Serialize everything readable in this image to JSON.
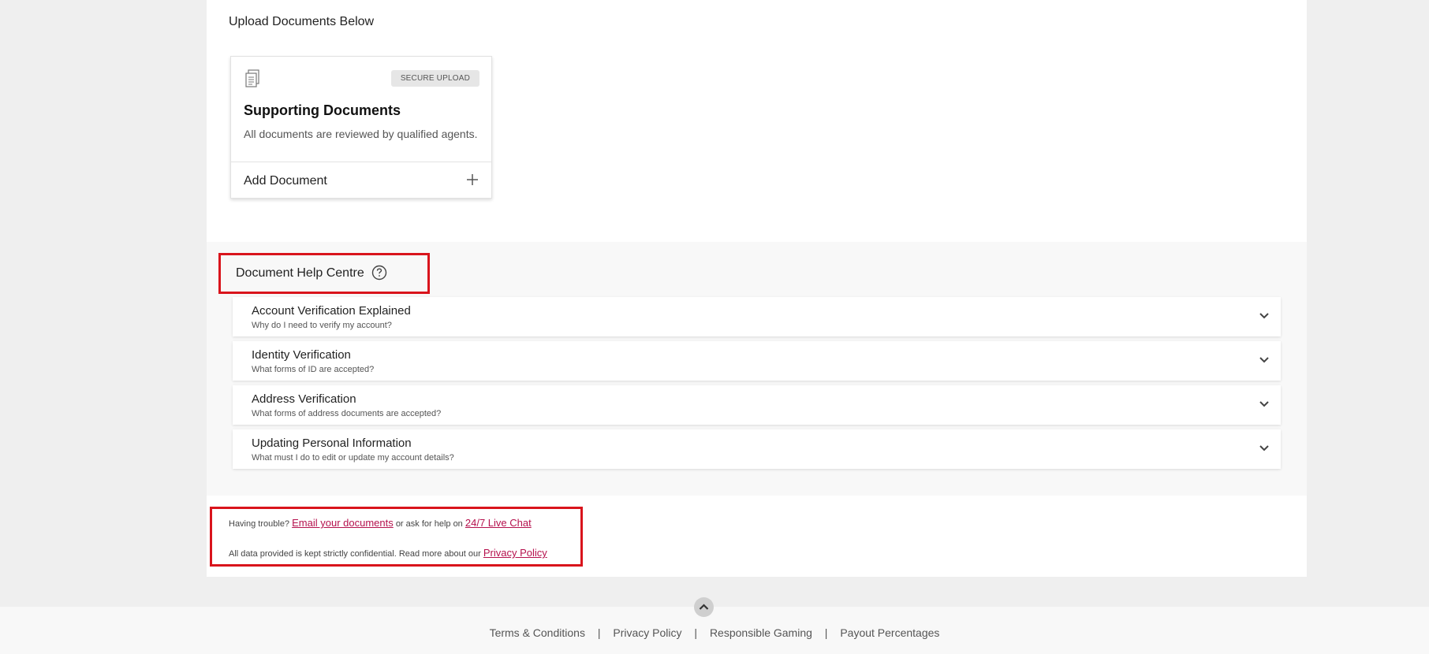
{
  "upload_section": {
    "heading": "Upload Documents Below"
  },
  "doc_card": {
    "icon": "document-icon",
    "badge": "SECURE UPLOAD",
    "title": "Supporting Documents",
    "description": "All documents are reviewed by qualified agents.",
    "add_label": "Add Document",
    "add_icon": "plus-icon"
  },
  "help_centre": {
    "title": "Document Help Centre",
    "icon": "question-circle-icon",
    "items": [
      {
        "title": "Account Verification Explained",
        "subtitle": "Why do I need to verify my account?"
      },
      {
        "title": "Identity Verification",
        "subtitle": "What forms of ID are accepted?"
      },
      {
        "title": "Address Verification",
        "subtitle": "What forms of address documents are accepted?"
      },
      {
        "title": "Updating Personal Information",
        "subtitle": "What must I do to edit or update my account details?"
      }
    ]
  },
  "trouble": {
    "prefix": "Having trouble?",
    "email_link": "Email your documents",
    "middle": "or ask for help on",
    "chat_link": "24/7 Live Chat",
    "confidential": "All data provided is kept strictly confidential. Read more about our",
    "privacy_link": "Privacy Policy"
  },
  "footer": {
    "links": [
      "Terms & Conditions",
      "Privacy Policy",
      "Responsible Gaming",
      "Payout Percentages"
    ],
    "separator": "|"
  },
  "colors": {
    "highlight_border": "#d9141c",
    "link": "#b5114d"
  }
}
